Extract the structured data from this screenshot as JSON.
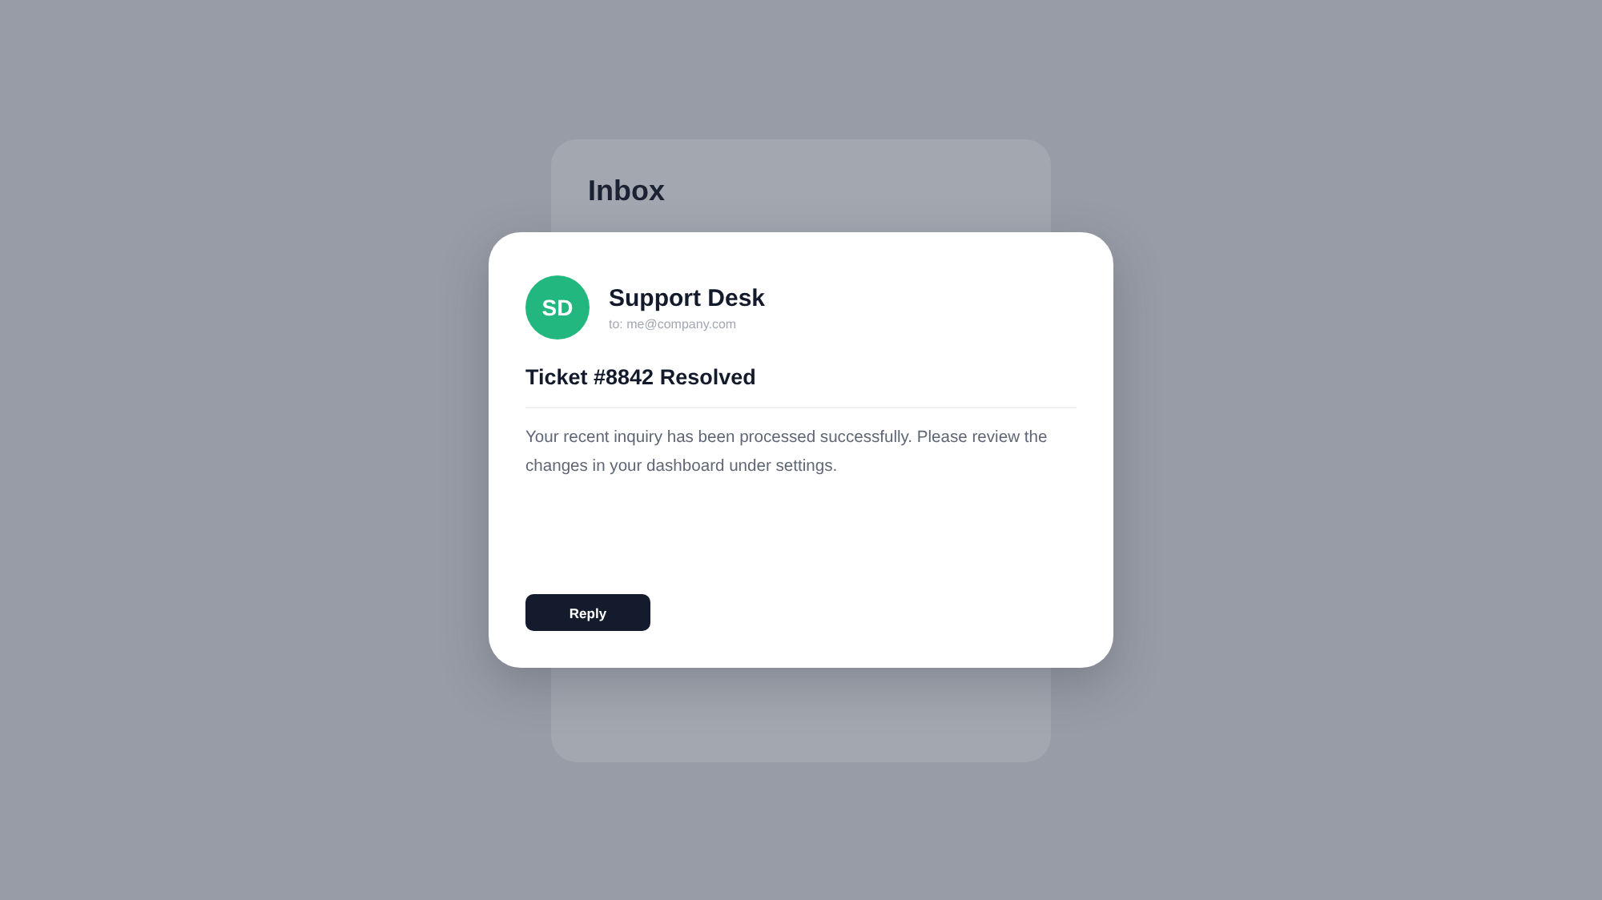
{
  "inbox": {
    "title": "Inbox"
  },
  "message": {
    "avatar": "SD",
    "sender": "Support Desk",
    "recipient": "to: me@company.com",
    "subject": "Ticket #8842 Resolved",
    "body": "Your recent inquiry has been processed successfully. Please review the changes in your dashboard under settings.",
    "button": "Reply"
  }
}
